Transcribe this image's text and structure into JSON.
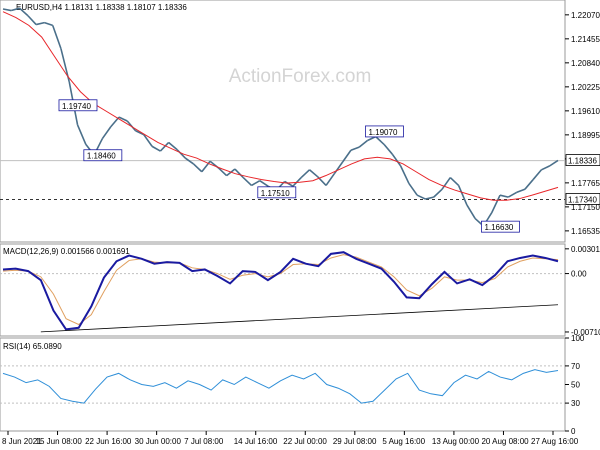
{
  "header": {
    "title": "EURUSD,H4  1.18131 1.18338 1.18107 1.18336"
  },
  "watermark": "ActionForex.com",
  "colors": {
    "price": "#4a6f8a",
    "ma": "#e8262a",
    "macd": "#1a1aa0",
    "signal": "#e0a060",
    "rsi": "#2f8fd8",
    "grid": "#c0c0c0",
    "label_border": "#1a1aa0"
  },
  "chart_data": [
    {
      "type": "line",
      "panel": "price",
      "title": "EURUSD,H4  1.18131 1.18338 1.18107 1.18336",
      "ylim": [
        1.1625,
        1.2245
      ],
      "yticks": [
        "1.22070",
        "1.21455",
        "1.20840",
        "1.20225",
        "1.19610",
        "1.18995",
        "1.18380",
        "1.17765",
        "1.17150",
        "1.16535"
      ],
      "ytick_values": [
        1.2207,
        1.21455,
        1.2084,
        1.20225,
        1.1961,
        1.18995,
        1.1838,
        1.17765,
        1.1715,
        1.16535
      ],
      "current_price": "1.18336",
      "current_value": 1.18336,
      "support_level": "1.17340",
      "support_value": 1.1734,
      "x_dates": [
        "8 Jun 2021",
        "15 Jun 08:00",
        "22 Jun 16:00",
        "30 Jun 00:00",
        "7 Jul 08:00",
        "14 Jul 16:00",
        "22 Jul 00:00",
        "29 Jul 08:00",
        "5 Aug 16:00",
        "13 Aug 00:00",
        "20 Aug 08:00",
        "27 Aug 16:00"
      ],
      "series": [
        {
          "name": "price",
          "values": [
            1.2222,
            1.2218,
            1.2224,
            1.2205,
            1.2182,
            1.2187,
            1.218,
            1.212,
            1.2035,
            1.1925,
            1.1875,
            1.1848,
            1.189,
            1.192,
            1.1945,
            1.1935,
            1.191,
            1.19,
            1.187,
            1.1858,
            1.188,
            1.1862,
            1.184,
            1.1825,
            1.1805,
            1.1832,
            1.1815,
            1.1795,
            1.1812,
            1.179,
            1.177,
            1.1782,
            1.1768,
            1.1758,
            1.178,
            1.1768,
            1.179,
            1.181,
            1.1792,
            1.177,
            1.18,
            1.183,
            1.186,
            1.1868,
            1.1885,
            1.1895,
            1.1875,
            1.185,
            1.182,
            1.1775,
            1.1745,
            1.1735,
            1.174,
            1.176,
            1.179,
            1.177,
            1.172,
            1.1685,
            1.1666,
            1.17,
            1.1745,
            1.174,
            1.1752,
            1.176,
            1.1785,
            1.181,
            1.182,
            1.1834
          ]
        },
        {
          "name": "moving-average",
          "values": [
            1.2215,
            1.22,
            1.218,
            1.215,
            1.21,
            1.205,
            1.201,
            1.198,
            1.196,
            1.194,
            1.192,
            1.19,
            1.188,
            1.1865,
            1.185,
            1.184,
            1.1825,
            1.1812,
            1.18,
            1.1792,
            1.1785,
            1.178,
            1.1776,
            1.1778,
            1.1782,
            1.1795,
            1.181,
            1.1825,
            1.1838,
            1.1842,
            1.1838,
            1.1825,
            1.1805,
            1.1785,
            1.177,
            1.1758,
            1.1748,
            1.1738,
            1.1732,
            1.1732,
            1.1736,
            1.1745,
            1.1755,
            1.1765
          ]
        }
      ],
      "annotations": [
        {
          "text": "1.19740",
          "x_index": 7,
          "value": 1.1974
        },
        {
          "text": "1.18460",
          "x_index": 10,
          "value": 1.1846
        },
        {
          "text": "1.17510",
          "x_index": 31,
          "value": 1.1751
        },
        {
          "text": "1.19070",
          "x_index": 44,
          "value": 1.1907
        },
        {
          "text": "1.16630",
          "x_index": 58,
          "value": 1.1663
        }
      ]
    },
    {
      "type": "line",
      "panel": "macd",
      "title": "MACD(12,26,9) 0.001566 0.001691",
      "ylim": [
        -0.0076,
        0.0036
      ],
      "yticks": [
        "0.003012",
        "0.00",
        "-0.007109"
      ],
      "ytick_values": [
        0.003012,
        0,
        -0.007109
      ],
      "series": [
        {
          "name": "macd",
          "values": [
            0.0005,
            0.0006,
            0.0003,
            -0.0008,
            -0.0045,
            -0.0068,
            -0.0066,
            -0.004,
            -0.0005,
            0.0015,
            0.0022,
            0.0018,
            0.0012,
            0.0014,
            0.0013,
            0.0003,
            0.0005,
            -0.0003,
            -0.0012,
            0.0003,
            0.0002,
            -0.0008,
            0.0002,
            0.0018,
            0.0012,
            0.0009,
            0.0024,
            0.0026,
            0.0018,
            0.0012,
            0.0006,
            -0.001,
            -0.0029,
            -0.003,
            -0.0013,
            0.0002,
            -0.0012,
            -0.0007,
            -0.0014,
            -0.0002,
            0.0015,
            0.0019,
            0.0022,
            0.0019,
            0.0015
          ]
        },
        {
          "name": "signal",
          "values": [
            0.0003,
            0.0004,
            0.0003,
            -0.0004,
            -0.0025,
            -0.0055,
            -0.0062,
            -0.005,
            -0.0022,
            0.0004,
            0.0016,
            0.0018,
            0.0014,
            0.0013,
            0.0013,
            0.0007,
            0.0005,
            0.0,
            -0.0007,
            -0.0002,
            0.0,
            -0.0004,
            0.0,
            0.0011,
            0.0012,
            0.0011,
            0.0019,
            0.0023,
            0.002,
            0.0014,
            0.0008,
            -0.0004,
            -0.002,
            -0.0027,
            -0.0018,
            -0.0004,
            -0.0008,
            -0.0008,
            -0.0011,
            -0.0006,
            0.0008,
            0.0015,
            0.0019,
            0.0018,
            0.0017
          ]
        }
      ],
      "trendline": {
        "start": [
          3,
          -0.0071
        ],
        "end": [
          44,
          -0.0038
        ]
      }
    },
    {
      "type": "line",
      "panel": "rsi",
      "title": "RSI(14) 65.0890",
      "ylim": [
        0,
        100
      ],
      "yticks": [
        "100",
        "70",
        "50",
        "30",
        "0"
      ],
      "ytick_values": [
        100,
        70,
        50,
        30,
        0
      ],
      "levels": [
        70,
        30
      ],
      "series": [
        {
          "name": "rsi",
          "values": [
            62,
            58,
            52,
            55,
            48,
            35,
            32,
            30,
            45,
            58,
            62,
            55,
            50,
            48,
            52,
            46,
            54,
            50,
            44,
            55,
            50,
            58,
            52,
            46,
            54,
            60,
            56,
            62,
            50,
            46,
            40,
            30,
            32,
            44,
            56,
            62,
            44,
            40,
            38,
            52,
            60,
            56,
            64,
            58,
            55,
            62,
            66,
            63,
            65
          ]
        }
      ]
    }
  ]
}
